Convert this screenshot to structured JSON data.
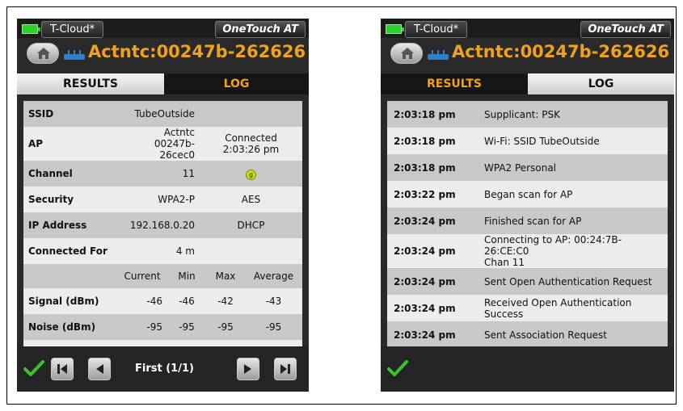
{
  "header": {
    "cloud_label": "T-Cloud*",
    "brand": "OneTouch AT",
    "ap_title": "Actntc:00247b-262626"
  },
  "left_panel": {
    "tabs": [
      {
        "label": "RESULTS",
        "active": true
      },
      {
        "label": "LOG",
        "active": false
      }
    ],
    "rows": [
      {
        "key": "SSID",
        "value1": "TubeOutside",
        "value2": ""
      },
      {
        "key": "AP",
        "value1a": "Actntc",
        "value1b": "00247b-26cec0",
        "value2a": "Connected",
        "value2b": "2:03:26 pm"
      },
      {
        "key": "Channel",
        "value1": "11",
        "badge": "g"
      },
      {
        "key": "Security",
        "value1": "WPA2-P",
        "value2": "AES"
      },
      {
        "key": "IP Address",
        "value1": "192.168.0.20",
        "value2": "DHCP"
      },
      {
        "key": "Connected For",
        "value1": "4 m",
        "value2": ""
      }
    ],
    "stats_headers": [
      "Current",
      "Min",
      "Max",
      "Average"
    ],
    "stats_rows": [
      {
        "key": "Signal (dBm)",
        "values": [
          "-46",
          "-46",
          "-42",
          "-43"
        ]
      },
      {
        "key": "Noise (dBm)",
        "values": [
          "-95",
          "-95",
          "-95",
          "-95"
        ]
      }
    ],
    "page_label": "First (1/1)"
  },
  "right_panel": {
    "tabs": [
      {
        "label": "RESULTS",
        "active": false
      },
      {
        "label": "LOG",
        "active": true
      }
    ],
    "log": [
      {
        "time": "2:03:18 pm",
        "message": "Supplicant: PSK"
      },
      {
        "time": "2:03:18 pm",
        "message": "Wi-Fi: SSID TubeOutside"
      },
      {
        "time": "2:03:18 pm",
        "message": "WPA2 Personal"
      },
      {
        "time": "2:03:22 pm",
        "message": "Began scan for AP"
      },
      {
        "time": "2:03:24 pm",
        "message": "Finished scan for AP"
      },
      {
        "time": "2:03:24 pm",
        "message": "Connecting to AP: 00:24:7B-26:CE:C0",
        "message2": "Chan 11"
      },
      {
        "time": "2:03:24 pm",
        "message": "Sent Open Authentication Request"
      },
      {
        "time": "2:03:24 pm",
        "message": "Received Open Authentication Success"
      },
      {
        "time": "2:03:24 pm",
        "message": "Sent Association Request"
      }
    ]
  },
  "colors": {
    "accent_orange": "#f0a21a",
    "status_green": "#2fce2f",
    "row_dark": "#c8c8c8",
    "row_light": "#ececec"
  },
  "icons": [
    "battery-icon",
    "home-icon",
    "wifi-ap-icon",
    "checkmark-icon",
    "first-page-icon",
    "prev-page-icon",
    "next-page-icon",
    "last-page-icon"
  ]
}
